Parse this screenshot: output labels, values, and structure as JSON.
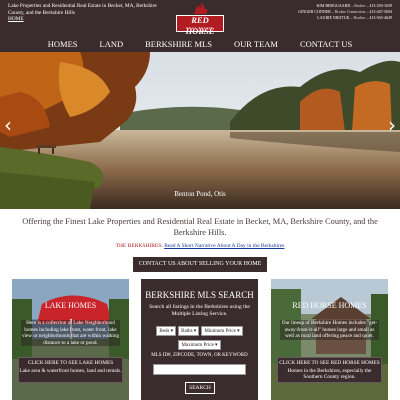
{
  "header": {
    "tagline": "Lake Properties and Residential Real Estate in Becket, MA, Berkshire County, and the Berkshire Hills",
    "home_link": "HOME",
    "logo_text": "RED HORSE",
    "logo_sub": "REAL ESTATE",
    "agents": [
      {
        "name": "KIM BERGGAARD",
        "role": "Broker",
        "phone": "413-250-1639"
      },
      {
        "name": "GINGER CONNER",
        "role": "Broker Connection",
        "phone": "413-447-5694"
      },
      {
        "name": "LAURIE NIKITUK",
        "role": "Realtor",
        "phone": "413-563-4649"
      }
    ]
  },
  "nav": {
    "items": [
      "HOMES",
      "LAND",
      "BERKSHIRE MLS",
      "OUR TEAM",
      "CONTACT US"
    ]
  },
  "hero": {
    "caption": "Benton Pond, Otis",
    "prev_icon": "chevron-left-icon",
    "next_icon": "chevron-right-icon"
  },
  "intro": {
    "text": "Offering the Finest Lake Properties and Residential Real Estate in Becket, MA, Berkshire County, and the Berkshire Hills.",
    "narrative_label": "THE BERKSHIRES:",
    "narrative_link": "Read A Short Narrative About A Day in the Berkshires",
    "contact_button": "CONTACT US ABOUT SELLING YOUR HOME"
  },
  "panels": {
    "lake": {
      "title": "LAKE HOMES",
      "description": "Here is a collection of Lake Neighborhood homes including lake front, water front, lake view or neighborhoods that are within walking distance to a lake or pond.",
      "button_main": "CLICK HERE TO SEE LAKE HOMES",
      "button_sub": "Lake area & waterfront homes, land and rentals."
    },
    "mls": {
      "title": "BERKSHIRE MLS SEARCH",
      "description": "Search all listings in the Berkshires using the Multiple Listing Service.",
      "beds": "Beds",
      "baths": "Baths",
      "min_price": "Minimum Price",
      "max_price": "Maximum Price",
      "field_label": "MLS ID#, ZIPCODE, TOWN, OR KEYWORD",
      "search_button": "SEARCH"
    },
    "redhorse": {
      "title": "RED HORSE HOMES",
      "description": "Our lineup of Berkshire Homes includes \"get-away-from-it-all\" homes large and small as well as rural land offering peace and quiet.",
      "button_main": "CLICK HERE TO SEE RED HORSE HOMES",
      "button_sub": "Homes in the Berkshires, especially the Southern County region."
    }
  },
  "colors": {
    "header_bg": "#3a2b2e",
    "accent_red": "#b11c22",
    "link_blue": "#1a3a9a"
  }
}
